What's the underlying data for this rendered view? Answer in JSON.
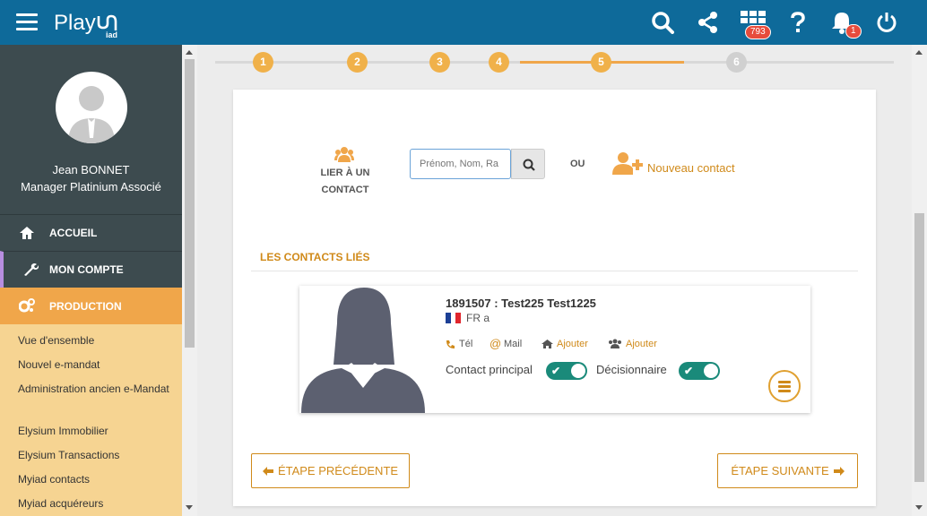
{
  "app": {
    "logo_text": "Play",
    "logo_sub": "iad",
    "badges": {
      "grid": "793",
      "bell": "1"
    }
  },
  "user": {
    "name": "Jean BONNET",
    "role": "Manager Platinium Associé"
  },
  "nav": [
    {
      "label": "ACCUEIL"
    },
    {
      "label": "MON COMPTE"
    },
    {
      "label": "PRODUCTION"
    }
  ],
  "subnav": [
    "Vue d'ensemble",
    "Nouvel e-mandat",
    "Administration ancien e-Mandat",
    "Elysium Immobilier",
    "Elysium Transactions",
    "Myiad contacts",
    "Myiad acquéreurs"
  ],
  "steps": [
    "1",
    "2",
    "3",
    "4",
    "5",
    "6"
  ],
  "link": {
    "label1": "LIER À UN",
    "label2": "CONTACT",
    "search_placeholder": "Prénom, Nom, Ra",
    "or": "OU",
    "new_contact": "Nouveau contact"
  },
  "contacts": {
    "section_title": "LES CONTACTS LIÉS",
    "card": {
      "title": "1891507 : Test225 Test1225",
      "locale": "FR a",
      "tel": "Tél",
      "mail": "Mail",
      "add1": "Ajouter",
      "add2": "Ajouter",
      "primary_label": "Contact principal",
      "decision_label": "Décisionnaire"
    }
  },
  "buttons": {
    "prev": "ÉTAPE PRÉCÉDENTE",
    "next": "ÉTAPE SUIVANTE"
  }
}
